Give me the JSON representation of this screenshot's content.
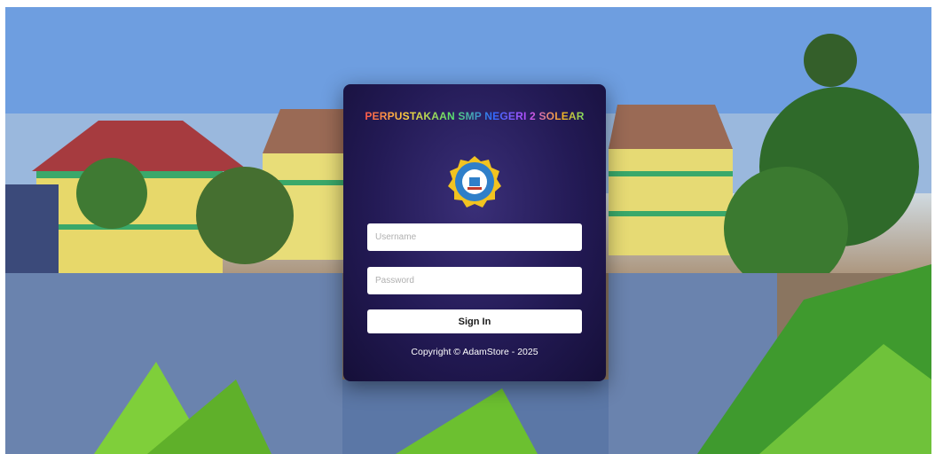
{
  "login": {
    "title": "PERPUSTAKAAN SMP NEGERI 2 SOLEAR",
    "username_placeholder": "Username",
    "password_placeholder": "Password",
    "signin_label": "Sign In",
    "copyright": "Copyright © AdamStore - 2025"
  },
  "theme": {
    "card_color": "#231a55",
    "logo_color": "#2f7fc9",
    "logo_border": "#f2c320"
  },
  "icons": {
    "logo": "school-emblem-icon"
  }
}
